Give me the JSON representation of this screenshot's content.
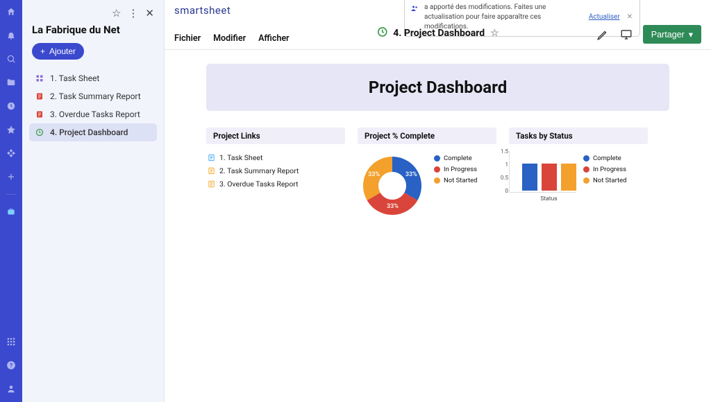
{
  "brand": "smartsheet",
  "notification": {
    "text": "a apporté des modifications. Faites une actualisation pour faire apparaître ces modifications.",
    "link": "Actualiser"
  },
  "workspace": {
    "title": "La Fabrique du Net",
    "add_label": "Ajouter"
  },
  "nav": {
    "items": [
      {
        "label": "1. Task Sheet",
        "icon": "grid",
        "color": "#8a6fd6"
      },
      {
        "label": "2. Task Summary Report",
        "icon": "report",
        "color": "#d9453a"
      },
      {
        "label": "3. Overdue Tasks Report",
        "icon": "report",
        "color": "#d9453a"
      },
      {
        "label": "4. Project Dashboard",
        "icon": "clock",
        "color": "#3b9e4c"
      }
    ],
    "active_index": 3
  },
  "menubar": {
    "file": "Fichier",
    "edit": "Modifier",
    "view": "Afficher"
  },
  "titlebar": {
    "title": "4. Project Dashboard"
  },
  "share_label": "Partager",
  "dashboard": {
    "title": "Project Dashboard",
    "widgets": {
      "links": {
        "title": "Project Links",
        "items": [
          {
            "label": "1. Task Sheet",
            "color": "#3fa9f5"
          },
          {
            "label": "2. Task Summary Report",
            "color": "#f5a623"
          },
          {
            "label": "3. Overdue Tasks Report",
            "color": "#f5a623"
          }
        ]
      },
      "pct": {
        "title": "Project % Complete"
      },
      "status": {
        "title": "Tasks by Status",
        "xlabel": "Status"
      }
    }
  },
  "chart_data": [
    {
      "type": "pie",
      "title": "Project % Complete",
      "series": [
        {
          "name": "Complete",
          "value": 33,
          "label": "33%",
          "color": "#2961c4"
        },
        {
          "name": "In Progress",
          "value": 33,
          "label": "33%",
          "color": "#d9453a"
        },
        {
          "name": "Not Started",
          "value": 33,
          "label": "33%",
          "color": "#f3a12c"
        }
      ]
    },
    {
      "type": "bar",
      "title": "Tasks by Status",
      "xlabel": "Status",
      "ylim": [
        0,
        1.5
      ],
      "yticks": [
        1.5,
        1,
        0.5,
        0
      ],
      "categories": [
        "Complete",
        "In Progress",
        "Not Started"
      ],
      "series": [
        {
          "name": "Complete",
          "value": 1,
          "color": "#2961c4"
        },
        {
          "name": "In Progress",
          "value": 1,
          "color": "#d9453a"
        },
        {
          "name": "Not Started",
          "value": 1,
          "color": "#f3a12c"
        }
      ]
    }
  ]
}
